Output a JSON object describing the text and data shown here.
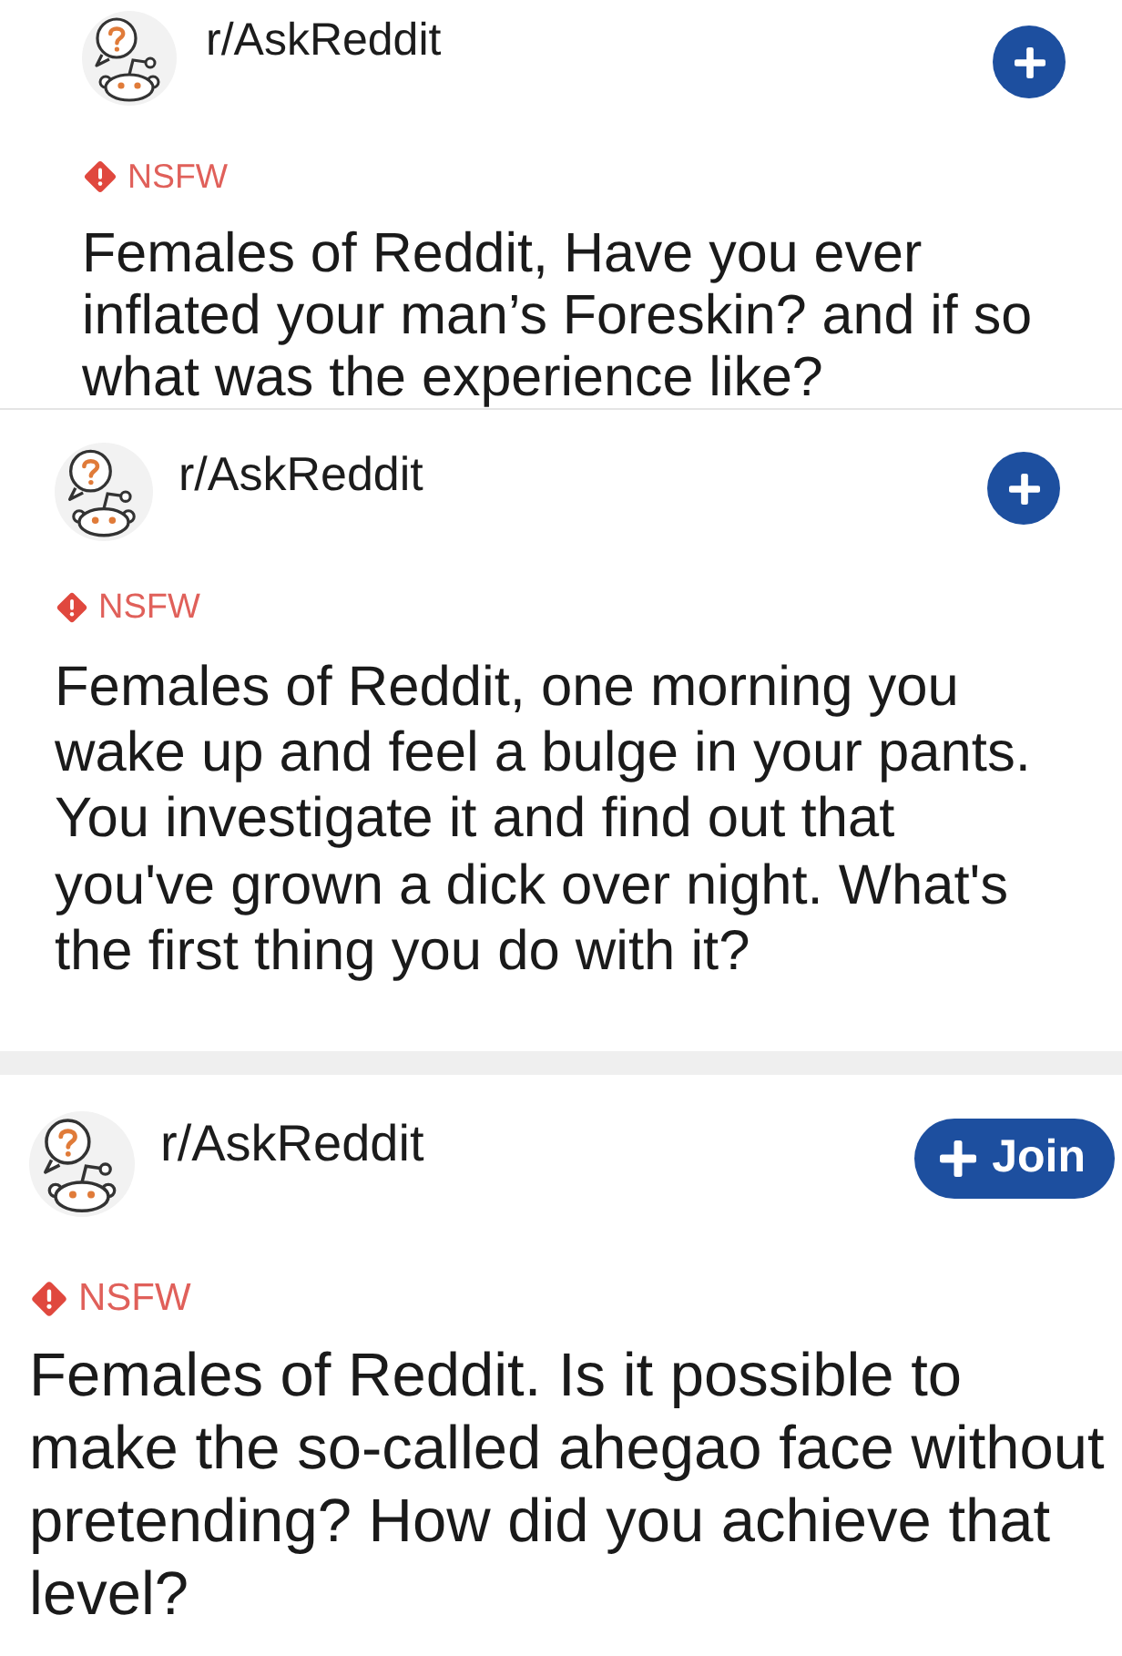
{
  "posts": [
    {
      "subreddit": "r/AskReddit",
      "tag": "NSFW",
      "title": "Females of Reddit, Have you ever inflated your man’s Foreskin? and if so what was the experience like?"
    },
    {
      "subreddit": "r/AskReddit",
      "tag": "NSFW",
      "title": "Females of Reddit, one morning you wake up and feel a bulge in your pants. You investigate it and find out that you've grown a dick over night. What's the first thing you do with it?"
    },
    {
      "subreddit": "r/AskReddit",
      "tag": "NSFW",
      "title": "Females of Reddit. Is it possible to make the so-called ahegao face without pretending? How did you achieve that level?",
      "join_label": "Join"
    }
  ]
}
